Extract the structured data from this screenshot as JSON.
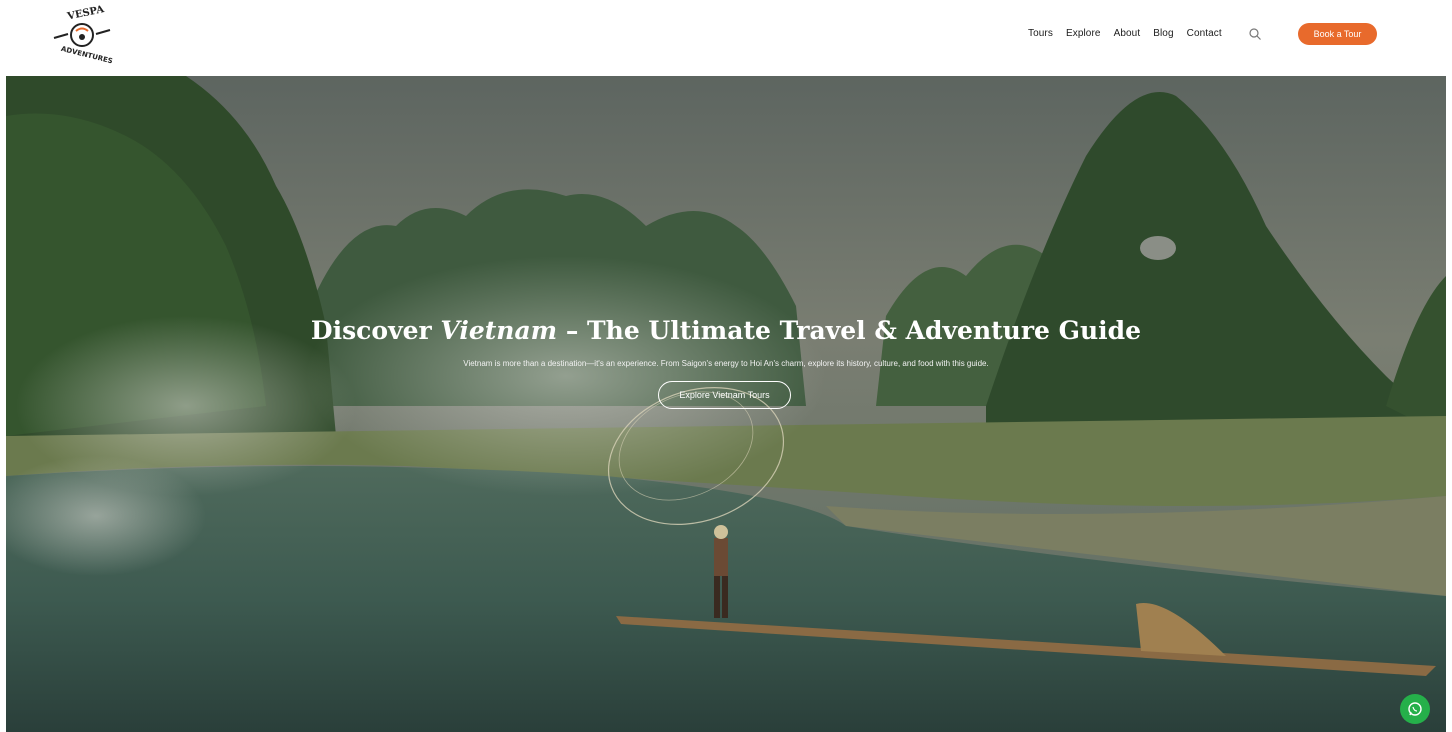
{
  "brand": {
    "logo_text": "VESPA ADVENTURES",
    "accent": "#e86a2c"
  },
  "nav": {
    "items": [
      "Tours",
      "Explore",
      "About",
      "Blog",
      "Contact"
    ],
    "search_icon": "search-icon",
    "cta_label": "Book a Tour"
  },
  "hero": {
    "title_pre": "Discover ",
    "title_em": "Vietnam",
    "title_post": " – The Ultimate Travel & Adventure Guide",
    "subtitle": "Vietnam is more than a destination—it's an experience. From Saigon's energy to Hoi An's charm, explore its history, culture, and food with this guide.",
    "cta_label": "Explore Vietnam Tours"
  },
  "floating": {
    "whatsapp_icon": "whatsapp-icon",
    "color": "#25b04a"
  }
}
